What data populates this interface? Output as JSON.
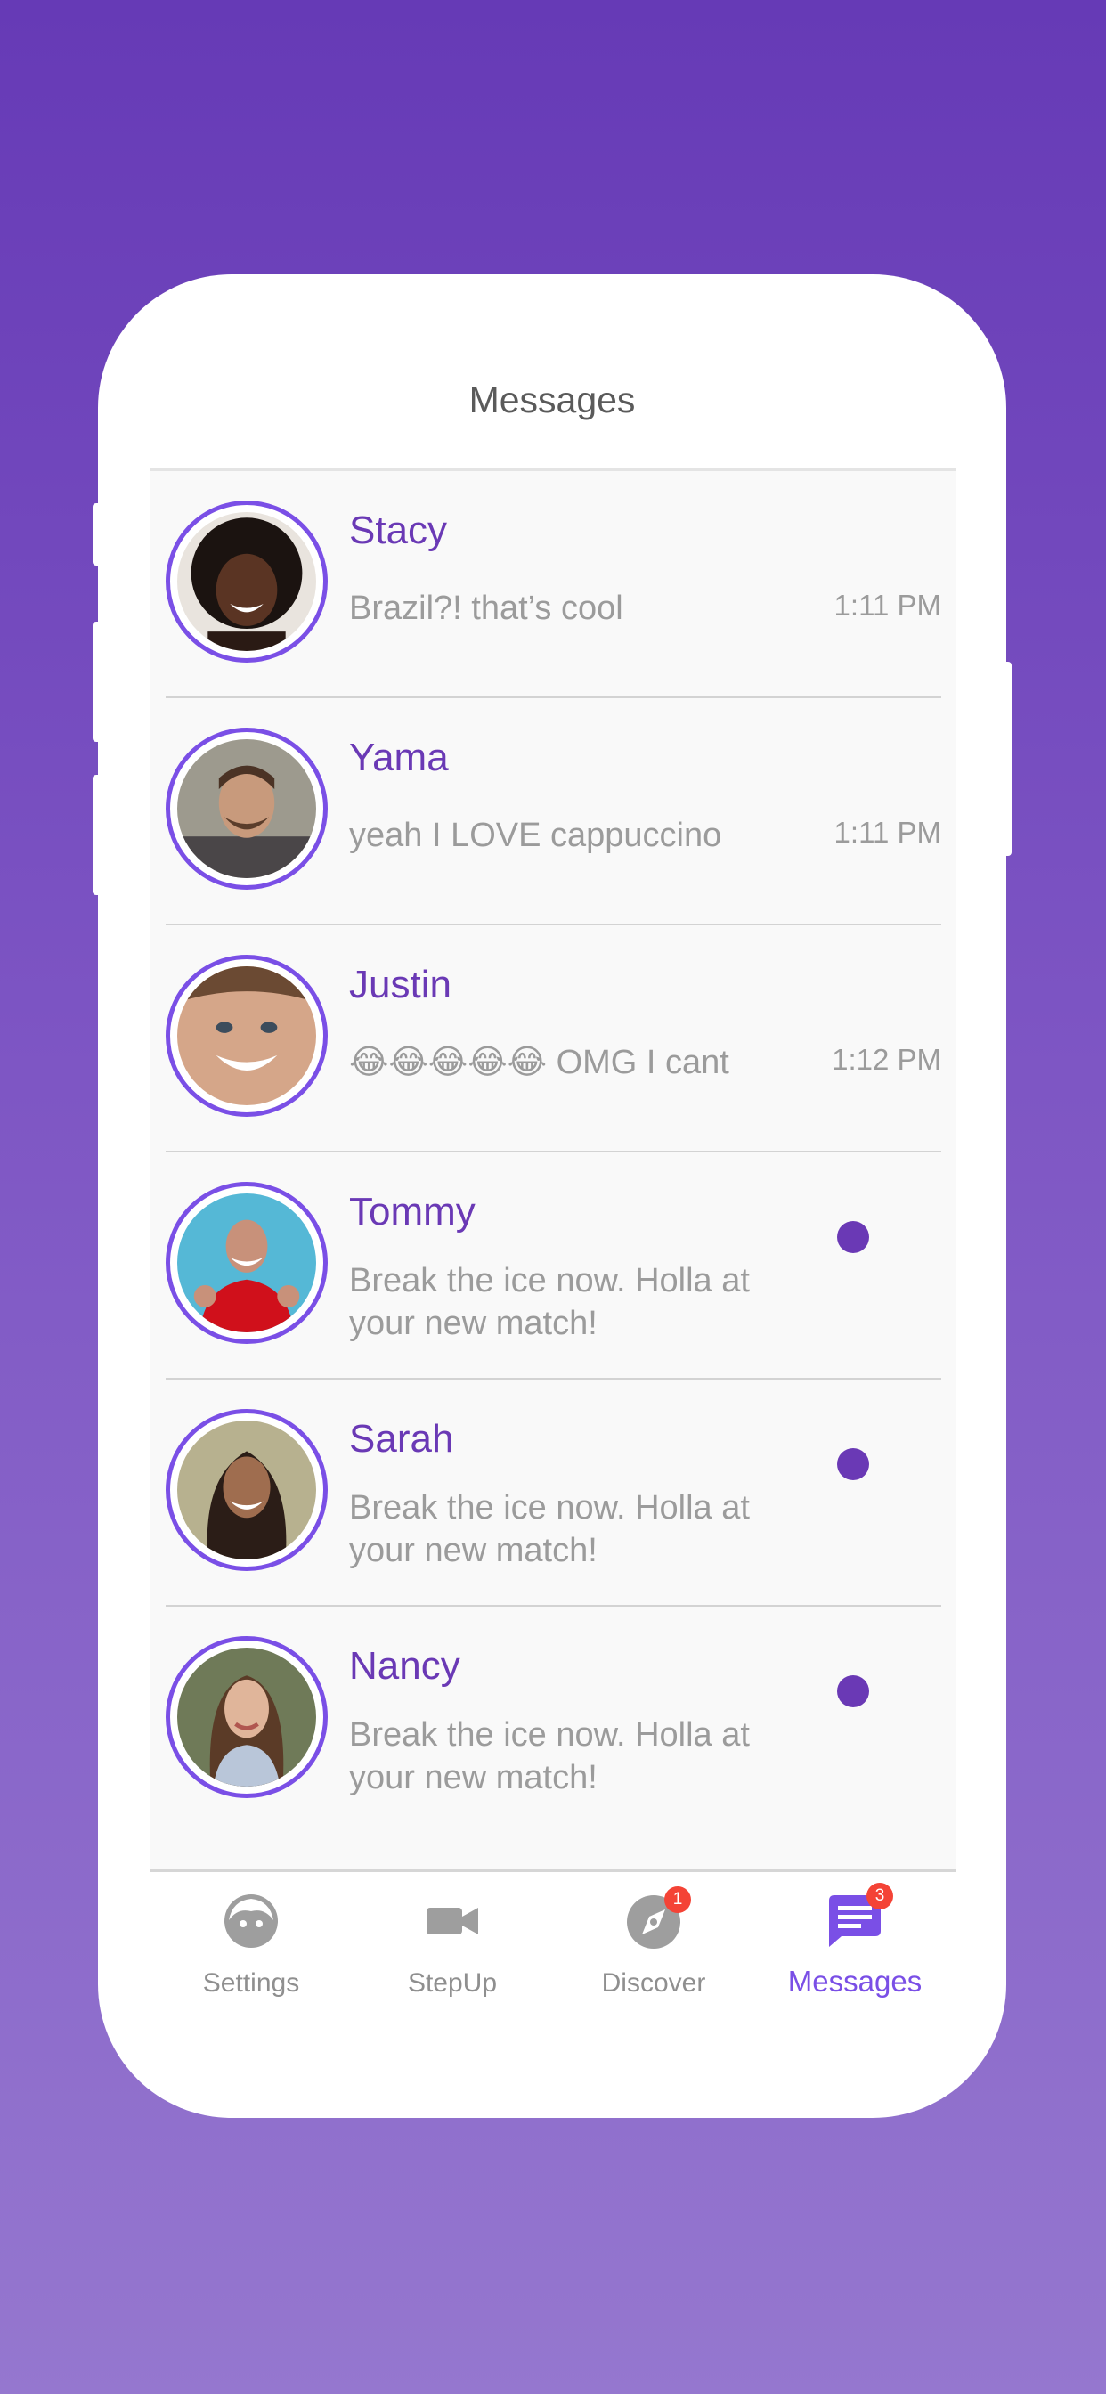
{
  "header": {
    "title": "Messages"
  },
  "conversations": [
    {
      "name": "Stacy",
      "preview": "Brazil?! that’s cool",
      "time": "1:11 PM",
      "unread": false
    },
    {
      "name": "Yama",
      "preview": "yeah I LOVE cappuccino",
      "time": "1:11 PM",
      "unread": false
    },
    {
      "name": "Justin",
      "preview": "😂😂😂😂😂 OMG I cant",
      "time": "1:12 PM",
      "unread": false
    },
    {
      "name": "Tommy",
      "preview": "Break the ice now. Holla at your new match!",
      "time": "",
      "unread": true
    },
    {
      "name": "Sarah",
      "preview": "Break the ice now. Holla at your new match!",
      "time": "",
      "unread": true
    },
    {
      "name": "Nancy",
      "preview": "Break the ice now. Holla at your new match!",
      "time": "",
      "unread": true
    }
  ],
  "tabs": [
    {
      "label": "Settings",
      "icon": "face-icon",
      "badge": ""
    },
    {
      "label": "StepUp",
      "icon": "video-camera-icon",
      "badge": ""
    },
    {
      "label": "Discover",
      "icon": "compass-icon",
      "badge": "1"
    },
    {
      "label": "Messages",
      "icon": "chat-icon",
      "badge": "3",
      "active": true
    }
  ],
  "colors": {
    "accent": "#7a4fe6",
    "name": "#6a39b5",
    "badge": "#f44336",
    "bg_top": "#663ab6",
    "bg_bottom": "#9577cf"
  }
}
